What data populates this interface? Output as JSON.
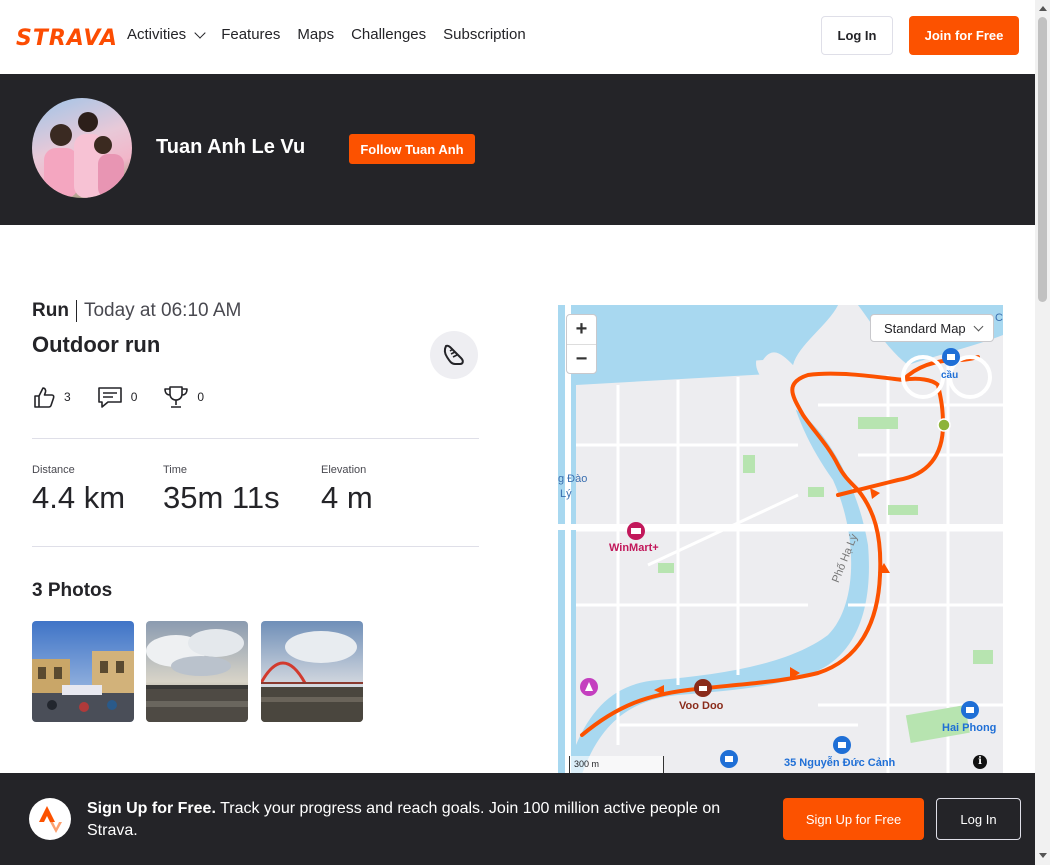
{
  "nav": {
    "logo": "STRAVA",
    "items": [
      "Activities",
      "Features",
      "Maps",
      "Challenges",
      "Subscription"
    ],
    "login": "Log In",
    "join": "Join for Free"
  },
  "profile": {
    "name": "Tuan Anh Le Vu",
    "follow": "Follow Tuan Anh"
  },
  "activity": {
    "type": "Run",
    "time": "Today at 06:10 AM",
    "title": "Outdoor run",
    "kudos": "3",
    "comments": "0",
    "achievements": "0",
    "stats": [
      {
        "label": "Distance",
        "value": "4.4 km"
      },
      {
        "label": "Time",
        "value": "35m 11s"
      },
      {
        "label": "Elevation",
        "value": "4 m"
      }
    ],
    "photos_title": "3 Photos"
  },
  "map": {
    "style": "Standard Map",
    "zoom_in": "+",
    "zoom_out": "−",
    "scale": "300 m",
    "info": "i",
    "labels": [
      "cầu",
      "WinMart+",
      "Voo Doo",
      "Phố Hạ Lý",
      "Hai Phong",
      "35 Nguyễn Đức Cảnh",
      "g Đào",
      "Lý",
      "C"
    ],
    "colors": {
      "route": "#fc5200",
      "water": "#a8d8f0",
      "park": "#b7e4b0",
      "road": "#ffffff"
    }
  },
  "signup": {
    "headline": "Sign Up for Free.",
    "body": "Track your progress and reach goals. Join 100 million active people on Strava.",
    "signup_btn": "Sign Up for Free",
    "login_btn": "Log In"
  },
  "colors": {
    "brand": "#fc5200",
    "dark": "#242428"
  }
}
